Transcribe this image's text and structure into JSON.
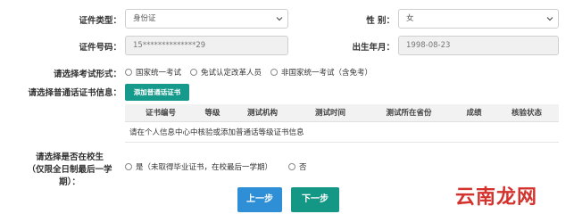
{
  "id_type": {
    "label": "证件类型：",
    "value": "身份证"
  },
  "gender": {
    "label": "性 别：",
    "value": "女"
  },
  "id_number": {
    "label": "证件号码：",
    "value": "15**************29"
  },
  "birth": {
    "label": "出生年月：",
    "value": "1998-08-23"
  },
  "exam_form": {
    "label": "请选择考试形式：",
    "options": [
      "国家统一考试",
      "免试认定改革人员",
      "非国家统一考试（含免考）"
    ]
  },
  "cert": {
    "label": "请选择普通话证书信息：",
    "add_button": "添加普通话证书",
    "columns": [
      "证书编号",
      "等级",
      "测试机构",
      "测试时间",
      "测试所在省份",
      "成绩",
      "核验状态"
    ],
    "note": "请在个人信息中心中核验或添加普通话等级证书信息"
  },
  "in_school": {
    "label_line1": "请选择是否在校生",
    "label_line2": "（仅限全日制最后一学期）：",
    "options": [
      "是（未取得毕业证书，在校最后一学期）",
      "否"
    ]
  },
  "nav": {
    "prev": "上一步",
    "next": "下一步"
  },
  "watermark": "云南龙网"
}
